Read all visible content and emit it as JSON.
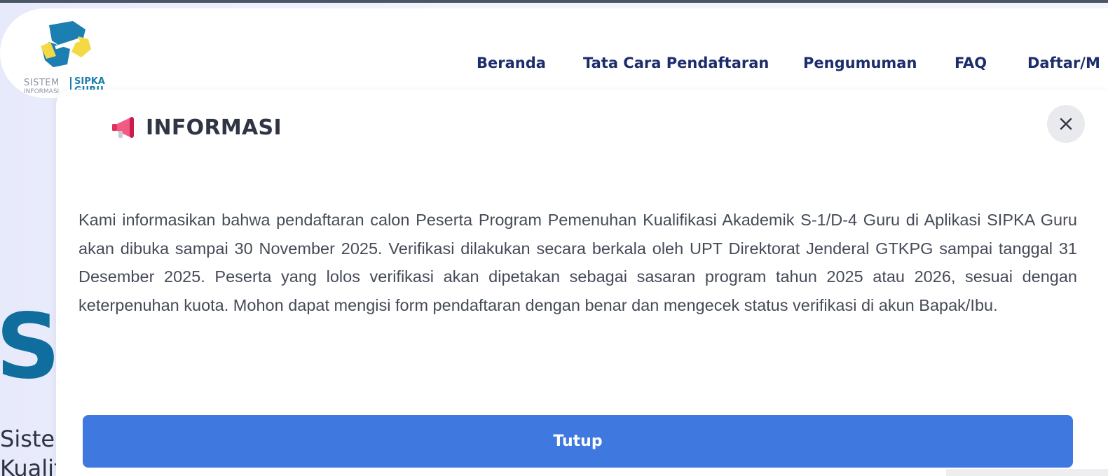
{
  "logo": {
    "text_left_line1": "SISTEM",
    "text_left_line2": "INFORMASI",
    "text_right_line1": "SIPKA",
    "text_right_line2": "GURU",
    "icon": "sipka-guru-logo-icon",
    "colors": {
      "blue": "#1b7fb1",
      "yellow": "#f3d944"
    }
  },
  "nav": {
    "items": [
      {
        "label": "Beranda"
      },
      {
        "label": "Tata Cara Pendaftaran"
      },
      {
        "label": "Pengumuman"
      },
      {
        "label": "FAQ"
      },
      {
        "label": "Daftar/M"
      }
    ]
  },
  "hero": {
    "letter": "S",
    "subtitle_line1": "Sister",
    "subtitle_line2": "Kualif"
  },
  "modal": {
    "icon": "megaphone-icon",
    "title": "INFORMASI",
    "close_icon": "close-icon",
    "body": "Kami informasikan bahwa pendaftaran calon Peserta Program Pemenuhan Kualifikasi Akademik S-1/D-4 Guru di Aplikasi SIPKA Guru akan dibuka sampai 30 November 2025. Verifikasi dilakukan secara berkala oleh UPT Direktorat Jenderal GTKPG sampai tanggal 31 Desember 2025. Peserta yang lolos verifikasi akan dipetakan sebagai sasaran program tahun 2025 atau 2026, sesuai dengan keterpenuhan kuota. Mohon dapat mengisi form pendaftaran dengan benar dan mengecek status verifikasi di akun Bapak/Ibu.",
    "button_label": "Tutup",
    "colors": {
      "button": "#3f78df",
      "title": "#2f3542"
    }
  }
}
